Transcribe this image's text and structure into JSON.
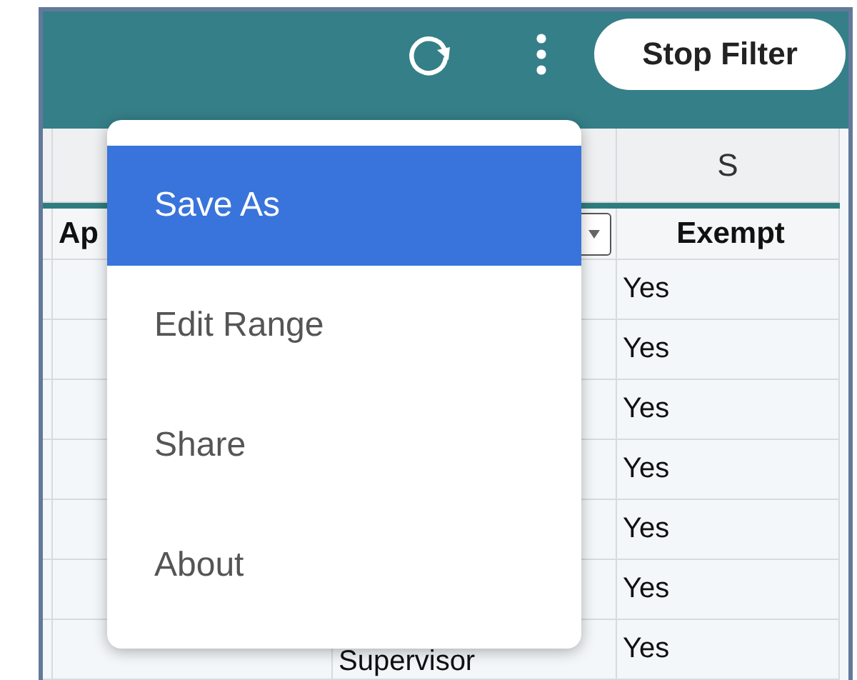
{
  "toolbar": {
    "button": "Stop Filter"
  },
  "table": {
    "column_letter": "S",
    "headers": [
      "Ap",
      "Exempt"
    ],
    "rows": [
      {
        "exempt": "Yes"
      },
      {
        "exempt": "Yes"
      },
      {
        "exempt": "Yes"
      },
      {
        "exempt": "Yes"
      },
      {
        "exempt": "Yes"
      },
      {
        "exempt": "Yes"
      },
      {
        "column_2": "Supervisor",
        "exempt": "Yes"
      }
    ]
  },
  "menu": {
    "items": [
      {
        "label": "Save As",
        "selected": true
      },
      {
        "label": "Edit Range",
        "selected": false
      },
      {
        "label": "Share",
        "selected": false
      },
      {
        "label": "About",
        "selected": false
      }
    ]
  }
}
